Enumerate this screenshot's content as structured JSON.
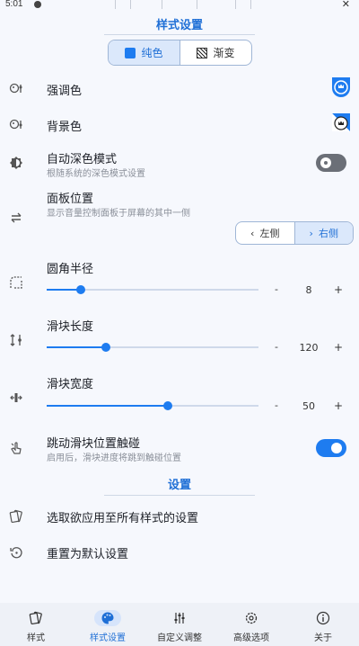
{
  "status": {
    "time": "5:01",
    "close": "✕"
  },
  "header": {
    "title": "样式设置"
  },
  "style_mode": {
    "options": [
      "纯色",
      "渐变"
    ],
    "selected": "纯色"
  },
  "accent": {
    "label": "强调色",
    "color": "#1e7cf0"
  },
  "background": {
    "label": "背景色",
    "color": "#1e7cf0"
  },
  "dark_mode": {
    "label": "自动深色模式",
    "sub": "根随系统的深色模式设置",
    "enabled": false
  },
  "panel": {
    "label": "面板位置",
    "sub": "显示音量控制面板于屏幕的其中一侧",
    "left": "左侧",
    "right": "右侧",
    "selected": "右侧"
  },
  "corner": {
    "label": "圆角半径",
    "value": "8",
    "fraction": 0.16
  },
  "slider_len": {
    "label": "滑块长度",
    "value": "120",
    "fraction": 0.28
  },
  "slider_width": {
    "label": "滑块宽度",
    "value": "50",
    "fraction": 0.57
  },
  "jump": {
    "label": "跳动滑块位置触碰",
    "sub": "启用后，滑块进度将跳到触碰位置",
    "enabled": true
  },
  "settings": {
    "title": "设置",
    "apply_all": "选取欲应用至所有样式的设置",
    "reset": "重置为默认设置"
  },
  "stepper": {
    "minus": "-",
    "plus": "+"
  },
  "nav": {
    "items": [
      {
        "label": "样式",
        "icon": "styles-icon"
      },
      {
        "label": "样式设置",
        "icon": "palette-icon"
      },
      {
        "label": "自定义调整",
        "icon": "sliders-icon"
      },
      {
        "label": "高级选项",
        "icon": "gear-icon"
      },
      {
        "label": "关于",
        "icon": "info-icon"
      }
    ],
    "active": 1
  },
  "colors": {
    "accent": "#1e7cf0",
    "active_text": "#1f6fd6"
  }
}
